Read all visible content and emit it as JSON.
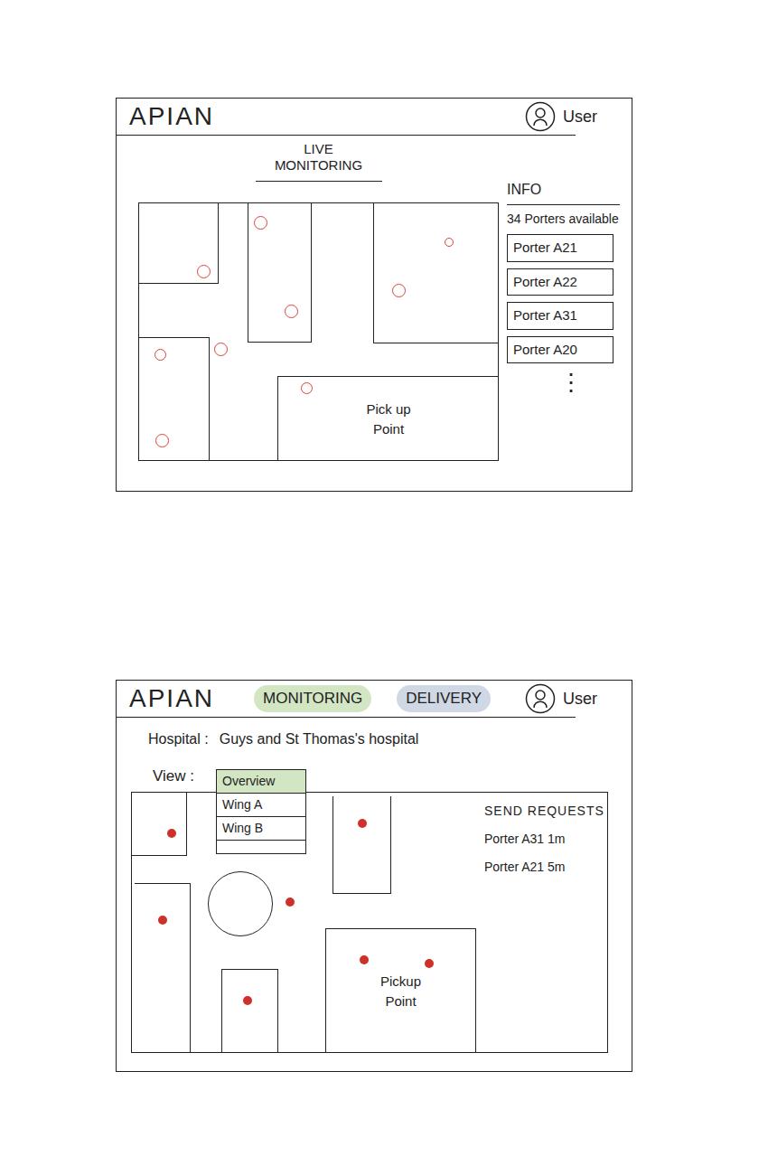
{
  "screen1": {
    "logo": "APIAN",
    "user": "User",
    "title": "LIVE MONITORING",
    "info": {
      "heading": "INFO",
      "count": "34 Porters available",
      "porters": [
        "Porter A21",
        "Porter A22",
        "Porter A31",
        "Porter A20"
      ],
      "more": "⋮"
    },
    "map": {
      "pickup": "Pick up Point",
      "pins": [
        {
          "kind": "ring"
        },
        {
          "kind": "ring"
        },
        {
          "kind": "ring"
        },
        {
          "kind": "ring"
        },
        {
          "kind": "ring"
        },
        {
          "kind": "ring"
        },
        {
          "kind": "ring"
        },
        {
          "kind": "ring"
        },
        {
          "kind": "ring"
        }
      ]
    }
  },
  "screen2": {
    "logo": "APIAN",
    "tabs": [
      {
        "label": "MONITORING",
        "color": "#d3e6c3"
      },
      {
        "label": "DELIVERY",
        "color": "#cfd8e4"
      }
    ],
    "user": "User",
    "hospital": {
      "label": "Hospital :",
      "value": "Guys and St Thomas's hospital"
    },
    "view": {
      "label": "View :",
      "options": [
        {
          "label": "Overview",
          "selected": true
        },
        {
          "label": "Wing A",
          "selected": false
        },
        {
          "label": "Wing B",
          "selected": false
        }
      ]
    },
    "requests": {
      "heading": "SEND REQUESTS",
      "items": [
        "Porter A31 1m",
        "Porter A21 5m"
      ]
    },
    "map": {
      "pickup": "Pickup Point",
      "pins": [
        {
          "kind": "dot"
        },
        {
          "kind": "dot"
        },
        {
          "kind": "dot"
        },
        {
          "kind": "dot"
        },
        {
          "kind": "dot"
        },
        {
          "kind": "dot"
        },
        {
          "kind": "dot"
        }
      ]
    }
  }
}
